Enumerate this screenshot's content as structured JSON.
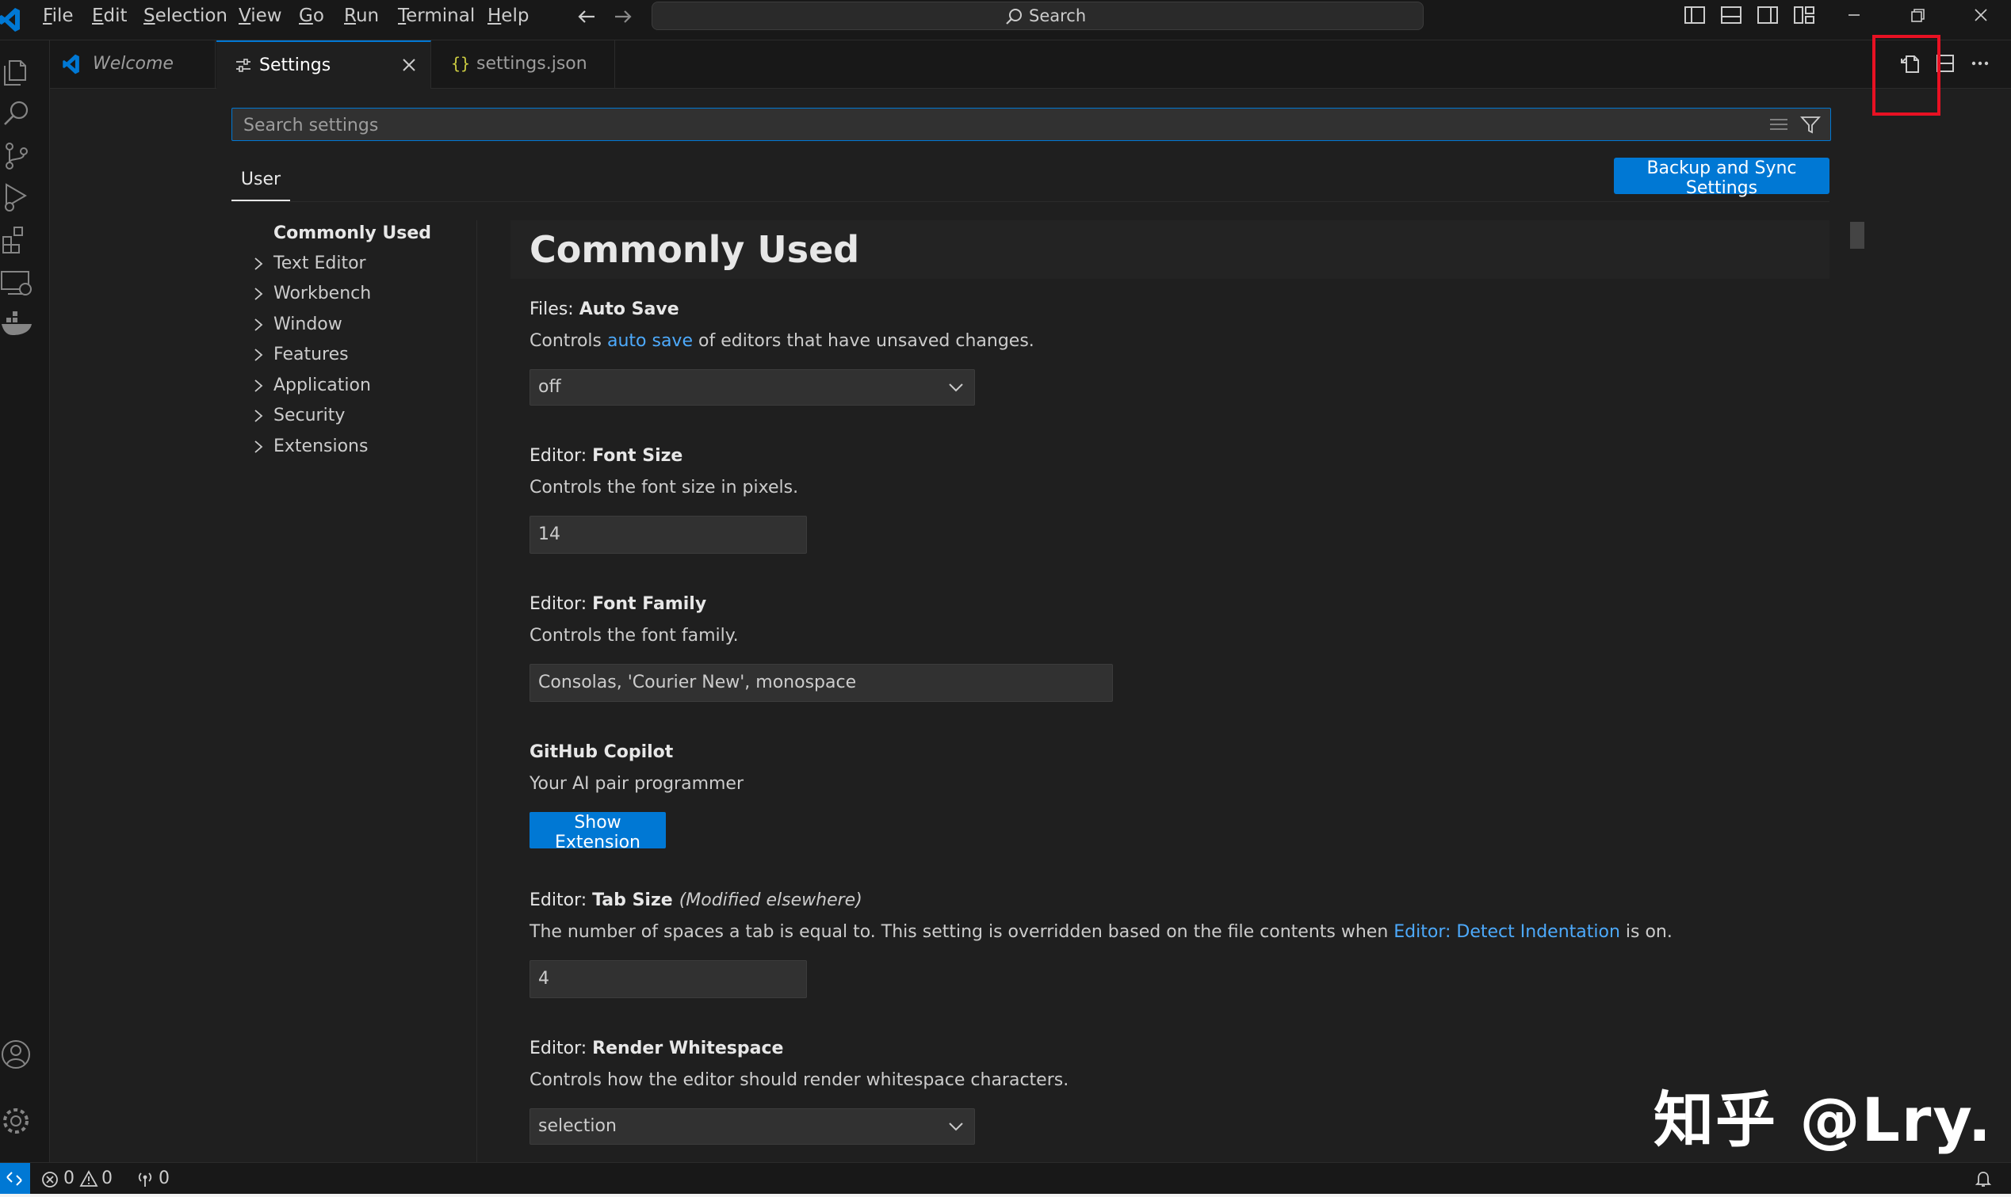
{
  "titlebar": {
    "menu": [
      {
        "label": "File",
        "underline": "F",
        "rest": "ile"
      },
      {
        "label": "Edit",
        "underline": "E",
        "rest": "dit"
      },
      {
        "label": "Selection",
        "underline": "S",
        "rest": "election"
      },
      {
        "label": "View",
        "underline": "V",
        "rest": "iew"
      },
      {
        "label": "Go",
        "underline": "G",
        "rest": "o"
      },
      {
        "label": "Run",
        "underline": "R",
        "rest": "un"
      },
      {
        "label": "Terminal",
        "underline": "T",
        "rest": "erminal"
      },
      {
        "label": "Help",
        "underline": "H",
        "rest": "elp"
      }
    ],
    "search_label": "Search"
  },
  "tabs": [
    {
      "label": "Welcome",
      "icon": "vscode-logo-icon",
      "italic": true
    },
    {
      "label": "Settings",
      "icon": "settings-sliders-icon",
      "active": true
    },
    {
      "label": "settings.json",
      "icon": "json-braces-icon"
    }
  ],
  "settings": {
    "search_placeholder": "Search settings",
    "scope_tab": "User",
    "sync_button": "Backup and Sync Settings",
    "toc": [
      {
        "label": "Commonly Used",
        "bold": true
      },
      {
        "label": "Text Editor"
      },
      {
        "label": "Workbench"
      },
      {
        "label": "Window"
      },
      {
        "label": "Features"
      },
      {
        "label": "Application"
      },
      {
        "label": "Security"
      },
      {
        "label": "Extensions"
      }
    ],
    "section_title": "Commonly Used",
    "items": {
      "auto_save": {
        "category": "Files: ",
        "name": "Auto Save",
        "desc_pre": "Controls ",
        "desc_link": "auto save",
        "desc_post": " of editors that have unsaved changes.",
        "value": "off"
      },
      "font_size": {
        "category": "Editor: ",
        "name": "Font Size",
        "desc": "Controls the font size in pixels.",
        "value": "14"
      },
      "font_family": {
        "category": "Editor: ",
        "name": "Font Family",
        "desc": "Controls the font family.",
        "value": "Consolas, 'Courier New', monospace"
      },
      "copilot": {
        "name": "GitHub Copilot",
        "desc": "Your AI pair programmer",
        "button": "Show Extension"
      },
      "tab_size": {
        "category": "Editor: ",
        "name": "Tab Size",
        "modified": "(Modified elsewhere)",
        "desc_pre": "The number of spaces a tab is equal to. This setting is overridden based on the file contents when ",
        "desc_link": "Editor: Detect Indentation",
        "desc_post": " is on.",
        "value": "4"
      },
      "render_whitespace": {
        "category": "Editor: ",
        "name": "Render Whitespace",
        "desc": "Controls how the editor should render whitespace characters.",
        "value": "selection"
      }
    }
  },
  "watermark": "知乎 @Lry.",
  "statusbar": {
    "errors": "0",
    "warnings": "0",
    "ports": "0"
  },
  "colors": {
    "accent": "#0078d4",
    "link": "#4daafc",
    "highlight_box": "#e81123",
    "background": "#1f1f1f"
  }
}
